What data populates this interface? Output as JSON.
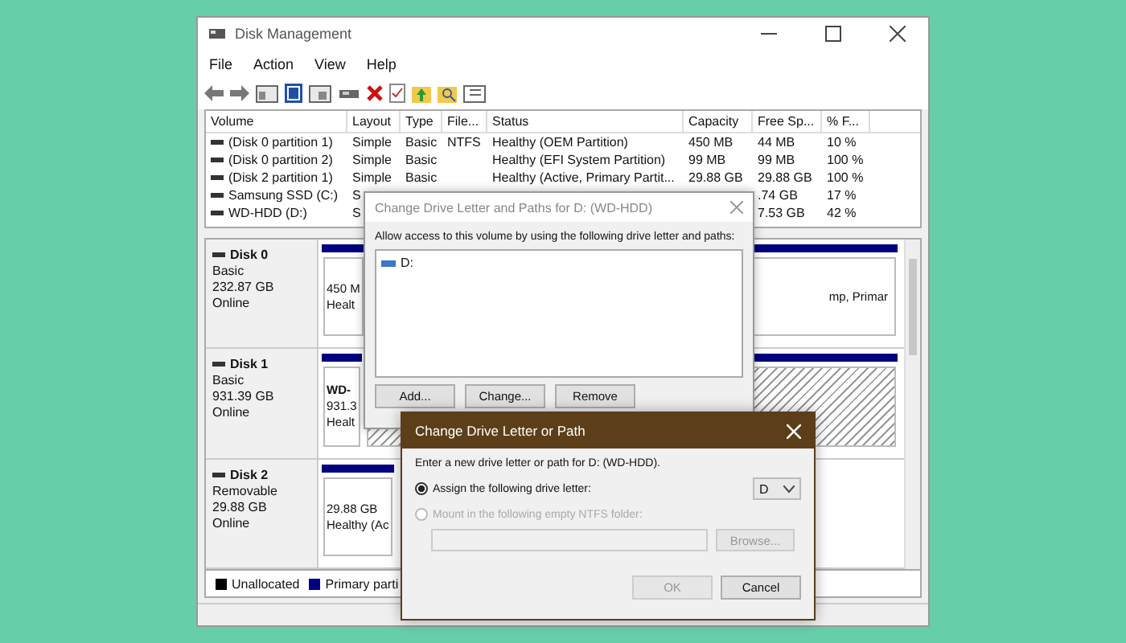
{
  "window": {
    "title": "Disk Management"
  },
  "menu": [
    "File",
    "Action",
    "View",
    "Help"
  ],
  "volume_table": {
    "columns": [
      "Volume",
      "Layout",
      "Type",
      "File...",
      "Status",
      "Capacity",
      "Free Sp...",
      "% F..."
    ],
    "rows": [
      {
        "volume": "(Disk 0 partition 1)",
        "layout": "Simple",
        "type": "Basic",
        "file_system": "NTFS",
        "status": "Healthy (OEM Partition)",
        "capacity": "450 MB",
        "free_space": "44 MB",
        "percent_free": "10 %"
      },
      {
        "volume": "(Disk 0 partition 2)",
        "layout": "Simple",
        "type": "Basic",
        "status": "Healthy (EFI System Partition)",
        "capacity": "99 MB",
        "free_space": "99 MB",
        "percent_free": "100 %"
      },
      {
        "volume": "(Disk 2 partition 1)",
        "layout": "Simple",
        "type": "Basic",
        "status": "Healthy (Active, Primary Partit...",
        "capacity": "29.88 GB",
        "free_space": "29.88 GB",
        "percent_free": "100 %"
      },
      {
        "volume": "Samsung SSD (C:)",
        "layout": "S",
        "free_space": ".74 GB",
        "percent_free": "17 %"
      },
      {
        "volume": "WD-HDD (D:)",
        "layout": "S",
        "free_space": "7.53 GB",
        "percent_free": "42 %"
      }
    ]
  },
  "disks": [
    {
      "name": "Disk 0",
      "type": "Basic",
      "size": "232.87 GB",
      "status": "Online",
      "partitions": [
        {
          "kind": "primary",
          "lines": [
            "450 M",
            "Healt"
          ]
        },
        {
          "kind": "primary",
          "lines": [
            "mp, Primar"
          ]
        }
      ]
    },
    {
      "name": "Disk 1",
      "type": "Basic",
      "size": "931.39 GB",
      "status": "Online",
      "partitions": [
        {
          "kind": "primary",
          "lines": [
            "WD-",
            "931.3",
            "Healt"
          ]
        },
        {
          "kind": "striped"
        }
      ]
    },
    {
      "name": "Disk 2",
      "type": "Removable",
      "size": "29.88 GB",
      "status": "Online",
      "partitions": [
        {
          "kind": "primary",
          "lines": [
            "29.88 GB",
            "Healthy (Ac"
          ]
        }
      ]
    }
  ],
  "legend": [
    {
      "label": "Unallocated",
      "color": "#000000"
    },
    {
      "label": "Primary parti",
      "color": "#000080"
    }
  ],
  "paths_dialog": {
    "title": "Change Drive Letter and Paths for D: (WD-HDD)",
    "instructions": "Allow access to this volume by using the following drive letter and paths:",
    "paths": [
      "D:"
    ],
    "buttons": [
      "Add...",
      "Change...",
      "Remove"
    ]
  },
  "letter_dialog": {
    "title": "Change Drive Letter or Path",
    "prompt": "Enter a new drive letter or path for D: (WD-HDD).",
    "options": [
      {
        "label": "Assign the following drive letter:",
        "selected": true,
        "disabled": false
      },
      {
        "label": "Mount in the following empty NTFS folder:",
        "selected": false,
        "disabled": true
      }
    ],
    "drive_letter": "D",
    "browse_button": {
      "label": "Browse...",
      "disabled": true
    },
    "buttons": [
      {
        "label": "OK",
        "disabled": true
      },
      {
        "label": "Cancel",
        "disabled": false
      }
    ]
  }
}
